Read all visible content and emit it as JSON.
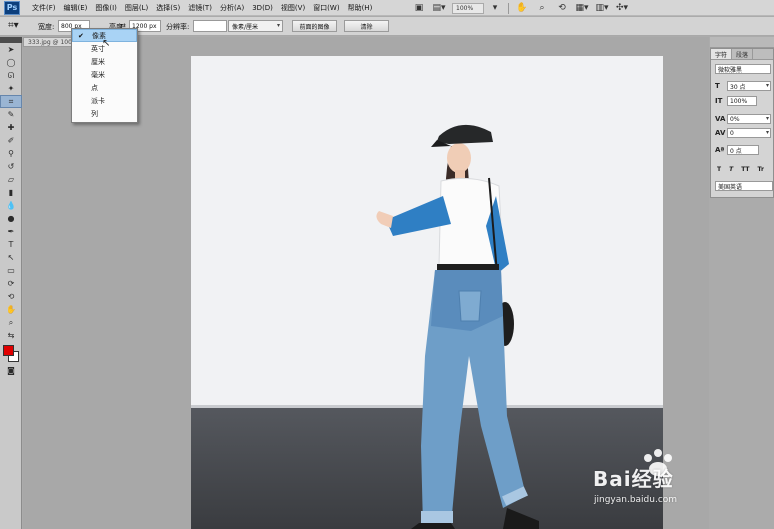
{
  "menubar": {
    "logo": "Ps",
    "items": [
      "文件(F)",
      "编辑(E)",
      "图像(I)",
      "图层(L)",
      "选择(S)",
      "滤镜(T)",
      "分析(A)",
      "3D(D)",
      "视图(V)",
      "窗口(W)",
      "帮助(H)"
    ],
    "zoom": "100%"
  },
  "options": {
    "width_label": "宽度:",
    "width_value": "800 px",
    "height_label": "高度:",
    "height_value": "1200 px",
    "resolution_label": "分辨率:",
    "resolution_value": "",
    "unit_value": "像素/厘米",
    "front_image_button": "前面的图像",
    "clear_button": "清除"
  },
  "dropdown": {
    "items": [
      "像素",
      "英寸",
      "厘米",
      "毫米",
      "点",
      "派卡",
      "列"
    ],
    "selected_index": 0
  },
  "document": {
    "tab_title": "333.jpg @ 100"
  },
  "character_panel": {
    "tabs": [
      "字符",
      "段落"
    ],
    "font_family": "微软雅黑",
    "font_size": "30 点",
    "vertical_scale": "100%",
    "tracking": "0%",
    "kerning": "0",
    "baseline_shift": "0 点",
    "styles": [
      "T",
      "T",
      "TT",
      "Tr"
    ],
    "language": "美国英语"
  },
  "watermark": {
    "logo_text": "Bai经验",
    "url": "jingyan.baidu.com"
  },
  "colors": {
    "foreground": "#e00000",
    "background": "#ffffff"
  }
}
